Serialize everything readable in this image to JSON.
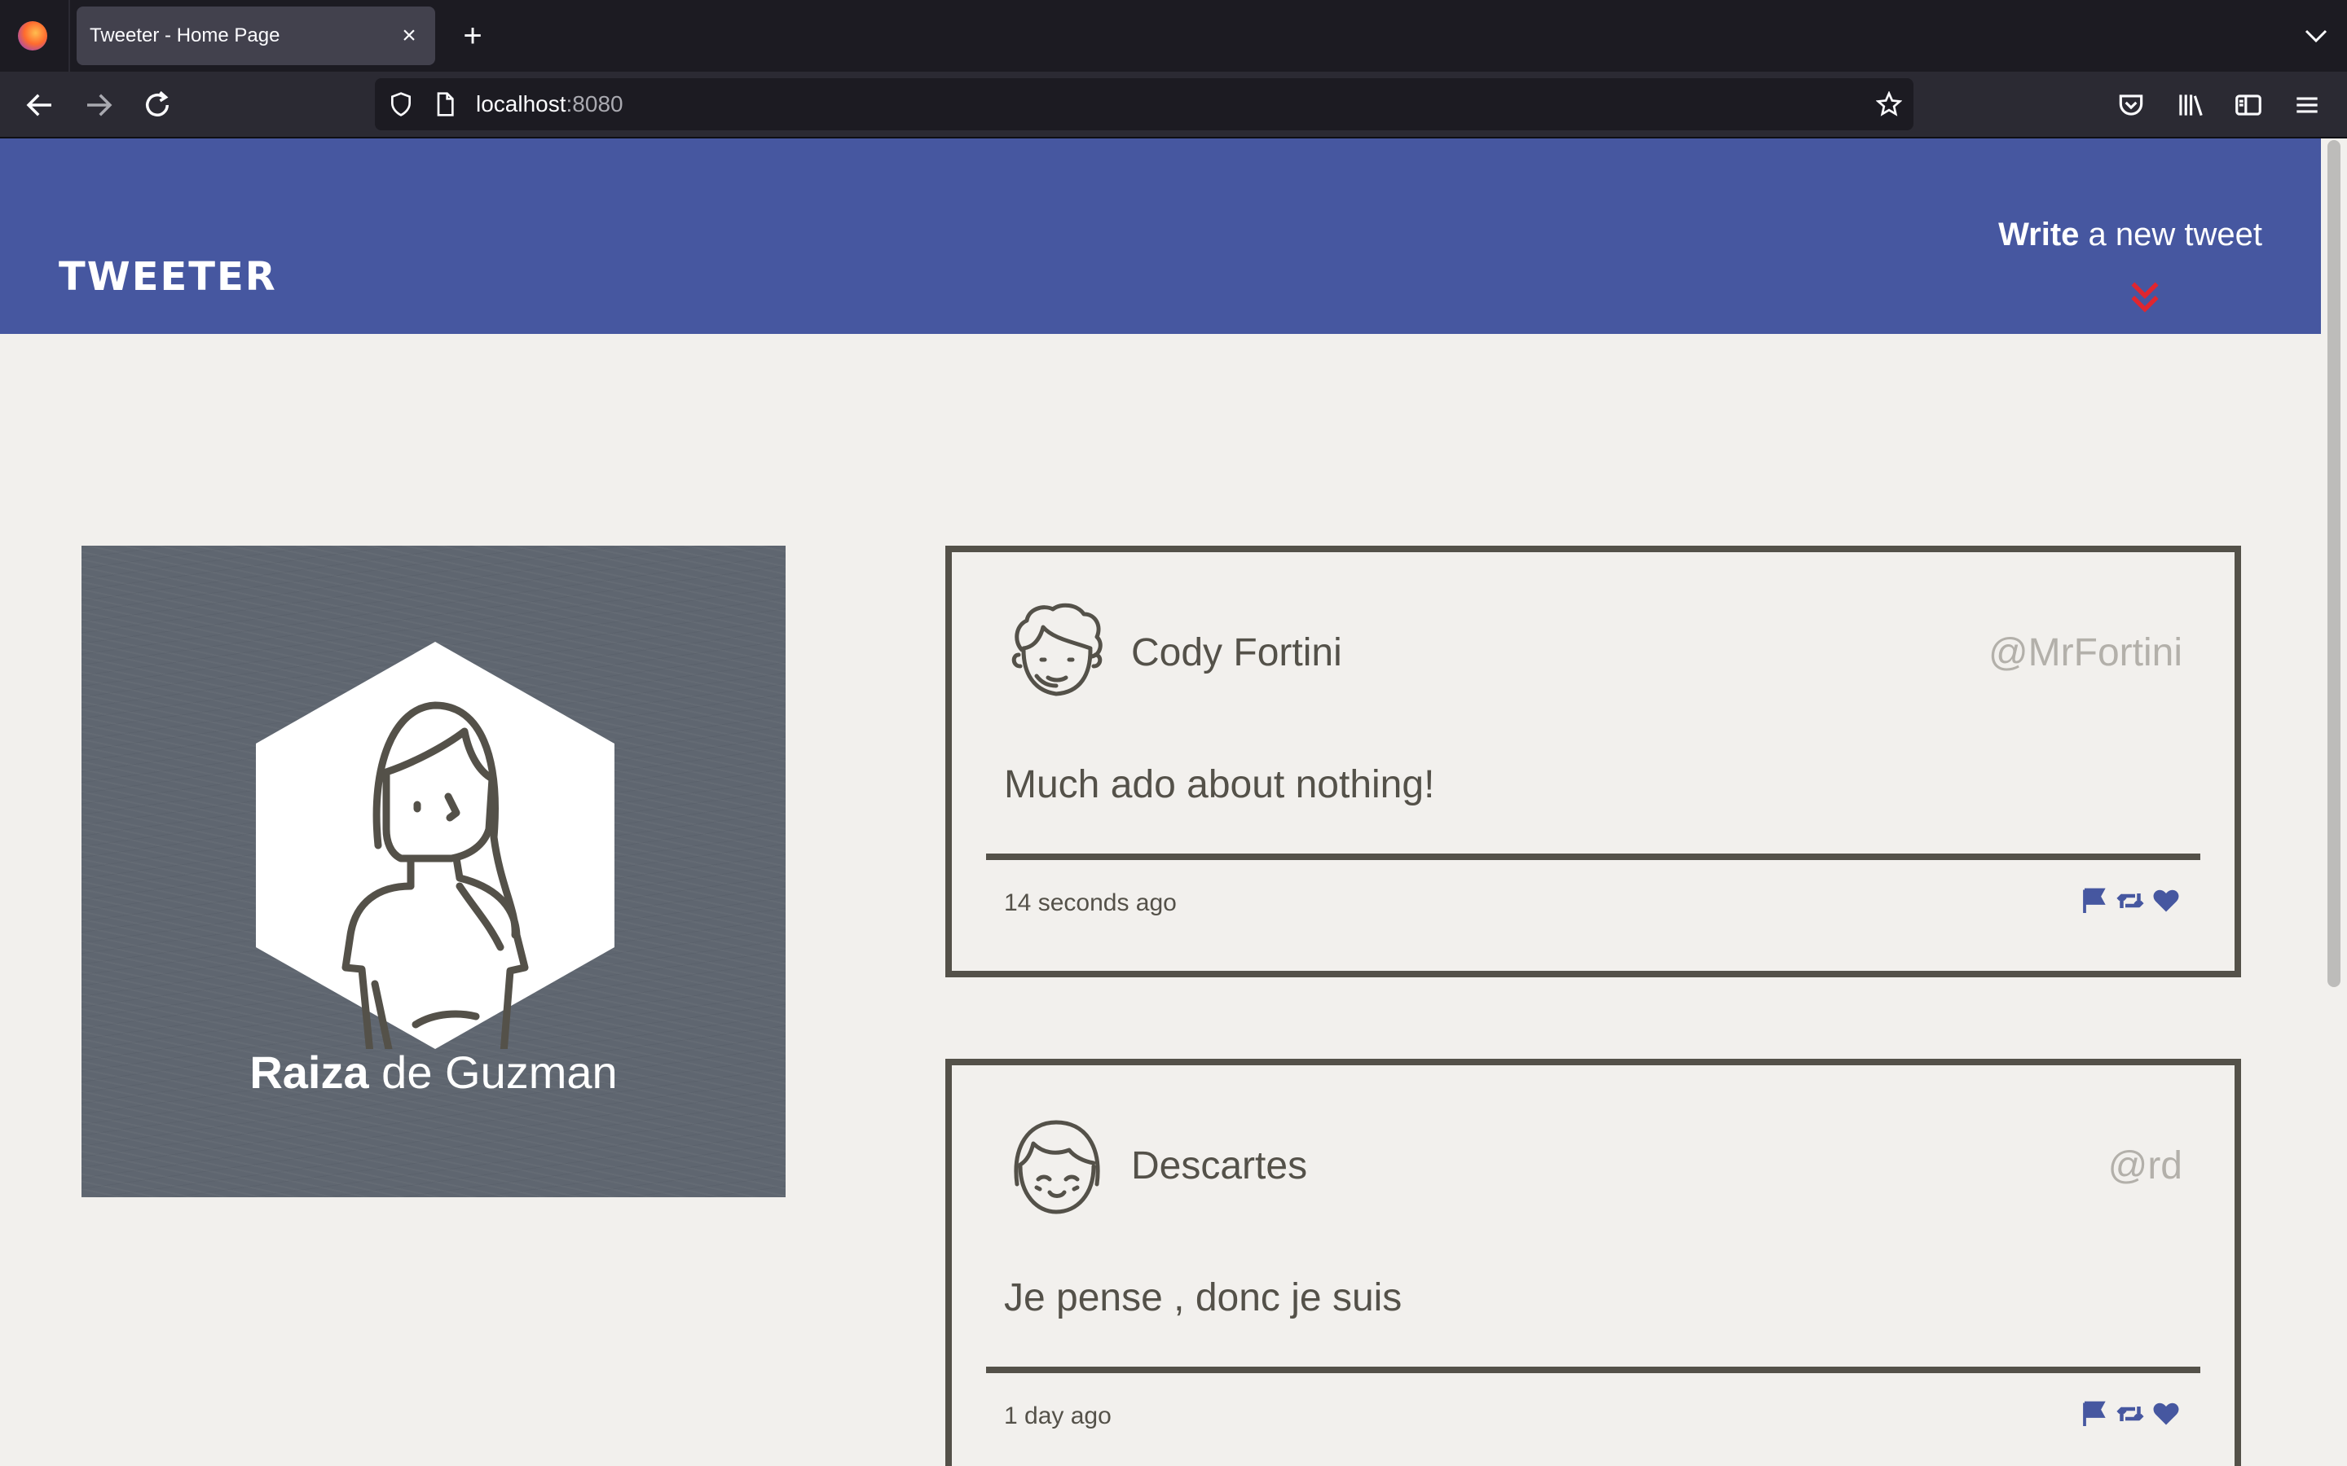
{
  "browser": {
    "tab_title": "Tweeter - Home Page",
    "url_host": "localhost",
    "url_port": ":8080"
  },
  "header": {
    "brand": "TWEETER",
    "compose_bold": "Write",
    "compose_rest": " a new tweet"
  },
  "profile": {
    "first_name": "Raiza",
    "last_name": " de Guzman"
  },
  "tweets": [
    {
      "name": "Cody Fortini",
      "handle": "@MrFortini",
      "text": "Much ado about nothing!",
      "time": "14 seconds ago"
    },
    {
      "name": "Descartes",
      "handle": "@rd",
      "text": "Je pense , donc je suis",
      "time": "1 day ago"
    }
  ],
  "colors": {
    "header_bg": "#4657a0",
    "accent_red": "#e0262f",
    "page_bg": "#f2f0ed",
    "border": "#545149",
    "icon_blue": "#4657a0"
  }
}
